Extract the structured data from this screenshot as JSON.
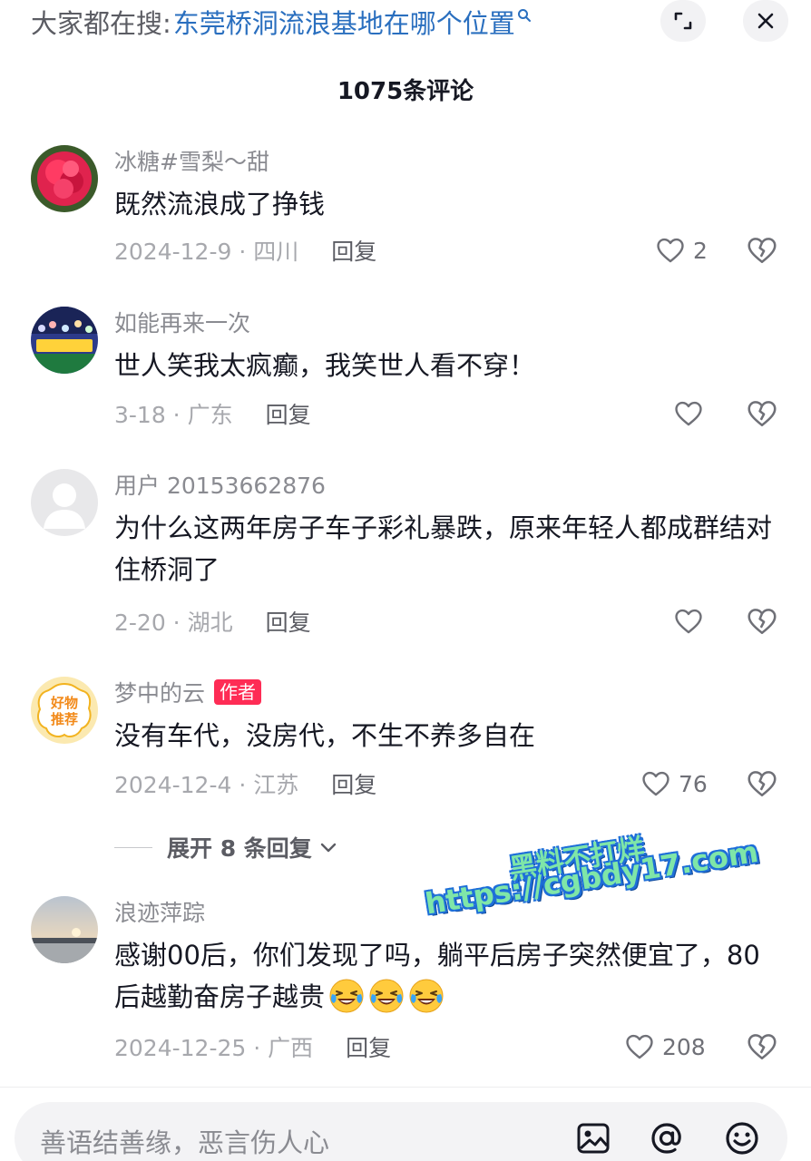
{
  "search": {
    "label": "大家都在搜:",
    "query": "东莞桥洞流浪基地在哪个位置"
  },
  "header": {
    "comment_count": "1075条评论"
  },
  "comments": [
    {
      "username": "冰糖#雪梨～甜",
      "text": "既然流浪成了挣钱",
      "meta": "2024-12-9 · 四川",
      "reply_label": "回复",
      "likes": "2",
      "avatar": "red-carnation"
    },
    {
      "username": "如能再来一次",
      "text": "世人笑我太疯癫，我笑世人看不穿！",
      "meta": "3-18 · 广东",
      "reply_label": "回复",
      "likes": "",
      "avatar": "stadium-crowd"
    },
    {
      "username": "用户 20153662876",
      "text": "为什么这两年房子车子彩礼暴跌，原来年轻人都成群结对住桥洞了",
      "meta": "2-20 · 湖北",
      "reply_label": "回复",
      "likes": "",
      "avatar": "default-user"
    },
    {
      "username": "梦中的云",
      "badge": "作者",
      "text": "没有车代，没房代，不生不养多自在",
      "meta": "2024-12-4 · 江苏",
      "reply_label": "回复",
      "likes": "76",
      "avatar": "haowu-tuijian",
      "avatar_text_1": "好物",
      "avatar_text_2": "推荐"
    },
    {
      "username": "浪迹萍踪",
      "text": "感谢00后，你们发现了吗，躺平后房子突然便宜了，80后越勤奋房子越贵",
      "meta": "2024-12-25 · 广西",
      "reply_label": "回复",
      "likes": "208",
      "avatar": "sunset-landscape",
      "emojis": [
        "laugh-cry-emoji",
        "laugh-cry-emoji",
        "laugh-cry-emoji"
      ]
    }
  ],
  "expand_replies": {
    "label": "展开 8 条回复"
  },
  "watermark": {
    "line1": "黑料不打烊",
    "line2": "https://cgbdy17.com"
  },
  "input": {
    "placeholder": "善语结善缘，恶言伤人心"
  },
  "icons": {
    "search_query": "search-icon",
    "expand": "expand-icon",
    "close": "close-icon",
    "like": "heart-icon",
    "dislike": "broken-heart-icon",
    "image": "image-icon",
    "mention": "at-icon",
    "emoji": "smiley-icon"
  },
  "colors": {
    "accent_link": "#2a6fbf",
    "author_badge": "#fe2c55",
    "text_primary": "#161823",
    "text_secondary": "#8a8b91"
  }
}
